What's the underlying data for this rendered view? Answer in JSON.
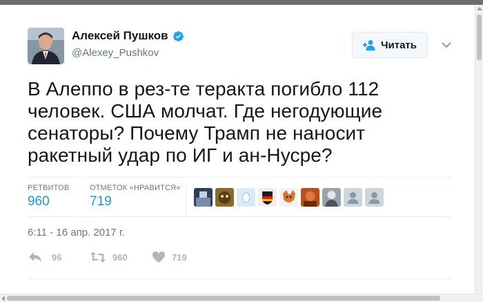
{
  "author": {
    "name": "Алексей Пушков",
    "handle": "@Alexey_Pushkov"
  },
  "follow_button": {
    "label": "Читать"
  },
  "tweet": {
    "text": "В Алеппо в рез-те теракта погибло 112 человек. США молчат. Где негодующие сенаторы? Почему Трамп не наносит ракетный удар по ИГ и ан-Нусре?",
    "timestamp": "6:11 - 16 апр. 2017 г."
  },
  "stats": {
    "retweets_label": "РЕТВИТОВ",
    "retweets": "960",
    "likes_label": "ОТМЕТОК «НРАВИТСЯ»",
    "likes": "719"
  },
  "actions": {
    "reply_count": "96",
    "retweet_count": "960",
    "like_count": "719"
  },
  "colors": {
    "link": "#1b95e0",
    "secondary_text": "#657786",
    "action_icon": "#aab8c2",
    "verified": "#1da1f2"
  },
  "likers_avatar_icons": [
    "avatar-1-icon",
    "avatar-2-icon",
    "avatar-3-icon",
    "avatar-4-icon",
    "avatar-5-icon",
    "avatar-6-icon",
    "avatar-7-icon",
    "avatar-default-icon",
    "avatar-default-icon"
  ]
}
